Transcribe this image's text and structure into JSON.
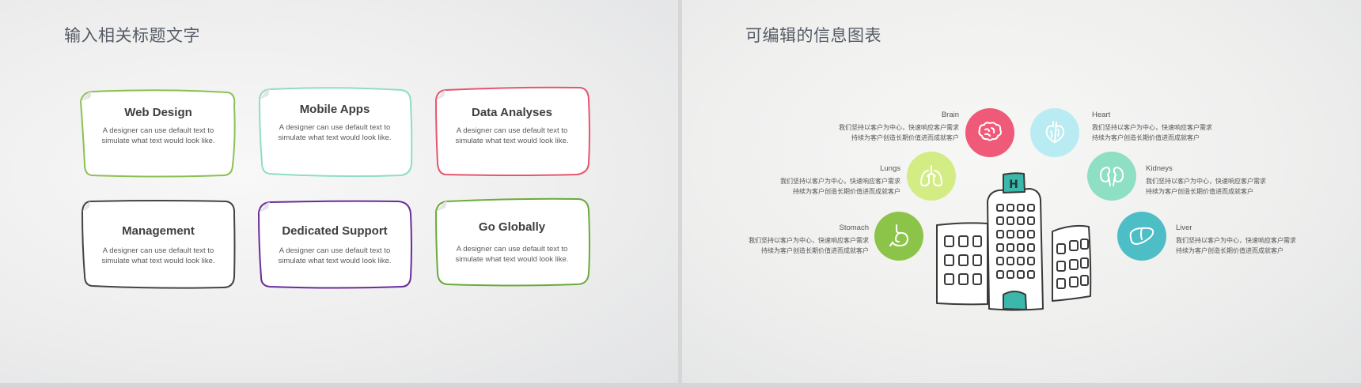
{
  "left_slide": {
    "title": "输入相关标题文字",
    "cards": [
      {
        "title": "Web Design",
        "desc": "A designer can use default text to simulate what text would look like.",
        "color": "#8cc152"
      },
      {
        "title": "Mobile Apps",
        "desc": "A designer can use default text to simulate what text would look like.",
        "color": "#8fdcc8"
      },
      {
        "title": "Data Analyses",
        "desc": "A designer can use default text to simulate what text would look like.",
        "color": "#e5556f"
      },
      {
        "title": "Management",
        "desc": "A designer can use default text to simulate what text would look like.",
        "color": "#444444"
      },
      {
        "title": "Dedicated Support",
        "desc": "A designer can use default text to simulate what text would look like.",
        "color": "#6a2c99"
      },
      {
        "title": "Go Globally",
        "desc": "A designer can use default text to simulate what text would look like.",
        "color": "#6aab3a"
      }
    ]
  },
  "right_slide": {
    "title": "可编辑的信息图表",
    "organs": [
      {
        "name": "Brain",
        "line1": "我们坚持以客户为中心，快速响应客户需求",
        "line2": "持续为客户创造长期价值进而成就客户",
        "color": "#ef5a78",
        "icon": "brain-icon"
      },
      {
        "name": "Heart",
        "line1": "我们坚持以客户为中心，快速响应客户需求",
        "line2": "持续为客户创造长期价值进而成就客户",
        "color": "#b9ecf2",
        "icon": "heart-icon"
      },
      {
        "name": "Lungs",
        "line1": "我们坚持以客户为中心，快速响应客户需求",
        "line2": "持续为客户创造长期价值进而成就客户",
        "color": "#d3ec84",
        "icon": "lungs-icon"
      },
      {
        "name": "Kidneys",
        "line1": "我们坚持以客户为中心，快速响应客户需求",
        "line2": "持续为客户创造长期价值进而成就客户",
        "color": "#8edfc4",
        "icon": "kidneys-icon"
      },
      {
        "name": "Stomach",
        "line1": "我们坚持以客户为中心，快速响应客户需求",
        "line2": "持续为客户创造长期价值进而成就客户",
        "color": "#8cc44a",
        "icon": "stomach-icon"
      },
      {
        "name": "Liver",
        "line1": "我们坚持以客户为中心，快速响应客户需求",
        "line2": "持续为客户创造长期价值进而成就客户",
        "color": "#4dbdc6",
        "icon": "liver-icon"
      }
    ],
    "hospital_sign": "H",
    "hospital_accent": "#3bb8ab"
  }
}
